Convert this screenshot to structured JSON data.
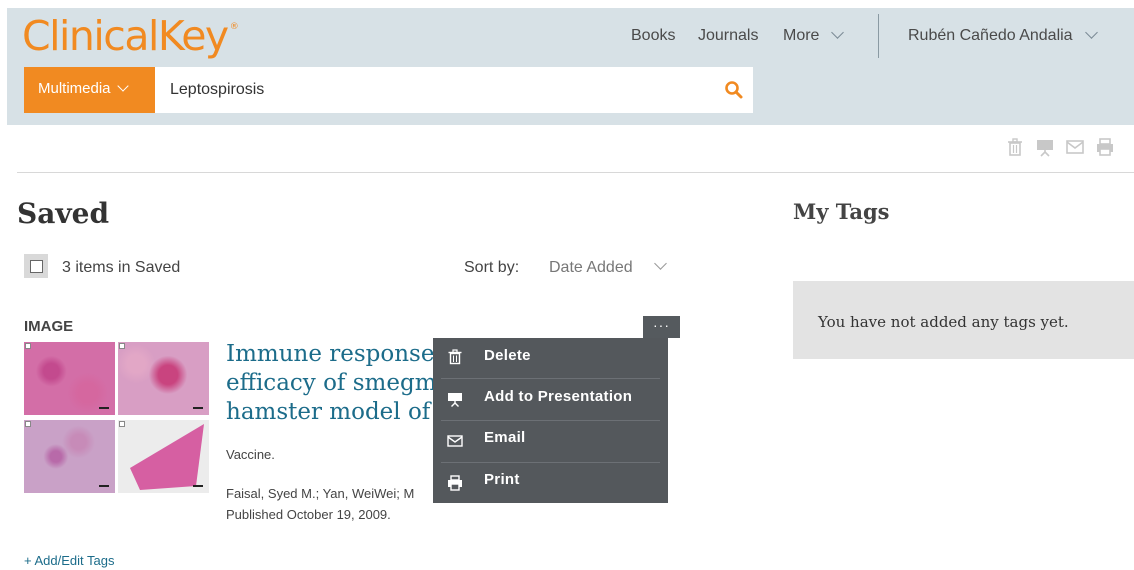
{
  "header": {
    "logo": "ClinicalKey",
    "logo_mark": "®",
    "nav": {
      "books": "Books",
      "journals": "Journals",
      "more": "More",
      "user": "Rubén Cañedo Andalia"
    },
    "search": {
      "scope": "Multimedia",
      "query": "Leptospirosis"
    },
    "accent_color": "#f18a21"
  },
  "toolbar": {
    "icons": [
      "trash-icon",
      "presentation-icon",
      "email-icon",
      "print-icon"
    ]
  },
  "saved": {
    "title": "Saved",
    "count_text": "3 items in Saved",
    "sort_label": "Sort by:",
    "sort_value": "Date Added",
    "item": {
      "type": "IMAGE",
      "more_label": "···",
      "title_lines": [
        "Immune response",
        "efficacy of smegm",
        "hamster model of"
      ],
      "source": "Vaccine.",
      "authors": "Faisal, Syed M.; Yan, WeiWei; M",
      "date": "Published October 19, 2009.",
      "tags_link": "+ Add/Edit Tags"
    }
  },
  "context_menu": {
    "items": [
      {
        "label": "Delete",
        "icon": "trash-icon"
      },
      {
        "label": "Add to Presentation",
        "icon": "presentation-icon"
      },
      {
        "label": "Email",
        "icon": "email-icon"
      },
      {
        "label": "Print",
        "icon": "print-icon"
      }
    ]
  },
  "my_tags": {
    "title": "My Tags",
    "empty_text": "You have not added any tags yet."
  }
}
